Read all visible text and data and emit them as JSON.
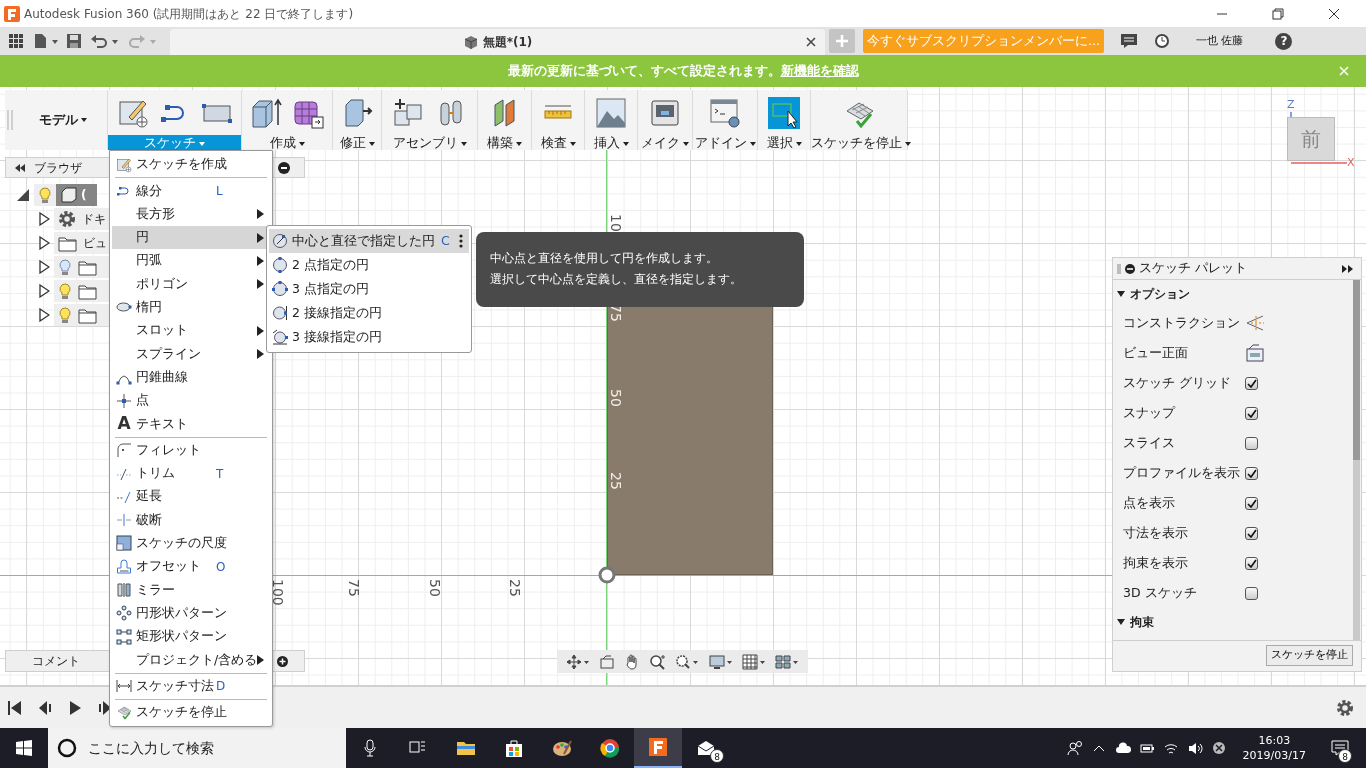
{
  "window": {
    "title": "Autodesk Fusion 360 (試用期間はあと 22 日で終了します)"
  },
  "tab_bar": {
    "document_tab": "無題*(1)",
    "subscribe_button": "今すぐサブスクリプションメンバーに...",
    "user": "一也 佐藤",
    "help": "?"
  },
  "banner": {
    "message": "最新の更新に基づいて、すべて設定されます。",
    "link": "新機能を確認"
  },
  "toolbar": {
    "workspace": "モデル",
    "groups": [
      {
        "label": "スケッチ",
        "selected": true,
        "active": false
      },
      {
        "label": "作成",
        "selected": false,
        "active": false
      },
      {
        "label": "修正",
        "selected": false,
        "active": false
      },
      {
        "label": "アセンブリ",
        "selected": false,
        "active": false
      },
      {
        "label": "構築",
        "selected": false,
        "active": false
      },
      {
        "label": "検査",
        "selected": false,
        "active": false
      },
      {
        "label": "挿入",
        "selected": false,
        "active": false
      },
      {
        "label": "メイク",
        "selected": false,
        "active": false
      },
      {
        "label": "アドイン",
        "selected": false,
        "active": false
      },
      {
        "label": "選択",
        "selected": false,
        "active": true
      },
      {
        "label": "スケッチを停止",
        "selected": false,
        "active": false
      }
    ]
  },
  "browser": {
    "title": "ブラウザ",
    "tree": [
      {
        "label": "(",
        "expanded": true,
        "visible": true,
        "children": [
          {
            "kind": "settings",
            "label": "ドキ",
            "expanded": false
          },
          {
            "kind": "folder",
            "label": "ビュ",
            "expanded": false
          },
          {
            "kind": "folder",
            "expanded": false,
            "visible": false
          },
          {
            "kind": "folder",
            "expanded": false,
            "visible": true
          },
          {
            "kind": "folder",
            "expanded": false,
            "visible": true
          }
        ]
      }
    ]
  },
  "sketch_menu": {
    "sections": [
      [
        {
          "label": "スケッチを作成",
          "submenu": false,
          "selected": false
        }
      ],
      [
        {
          "label": "線分",
          "shortcut": "L",
          "submenu": false,
          "selected": false
        },
        {
          "label": "長方形",
          "submenu": true,
          "selected": false
        },
        {
          "label": "円",
          "submenu": true,
          "selected": true
        },
        {
          "label": "円弧",
          "submenu": true,
          "selected": false
        },
        {
          "label": "ポリゴン",
          "submenu": true,
          "selected": false
        },
        {
          "label": "楕円",
          "submenu": false,
          "selected": false
        },
        {
          "label": "スロット",
          "submenu": true,
          "selected": false
        },
        {
          "label": "スプライン",
          "submenu": true,
          "selected": false
        },
        {
          "label": "円錐曲線",
          "submenu": false,
          "selected": false
        },
        {
          "label": "点",
          "submenu": false,
          "selected": false
        },
        {
          "label": "テキスト",
          "glyph": "A",
          "submenu": false,
          "selected": false
        }
      ],
      [
        {
          "label": "フィレット",
          "submenu": false,
          "selected": false
        },
        {
          "label": "トリム",
          "shortcut": "T",
          "submenu": false,
          "selected": false
        },
        {
          "label": "延長",
          "submenu": false,
          "selected": false
        },
        {
          "label": "破断",
          "submenu": false,
          "selected": false
        },
        {
          "label": "スケッチの尺度",
          "submenu": false,
          "selected": false
        },
        {
          "label": "オフセット",
          "shortcut": "O",
          "submenu": false,
          "selected": false
        },
        {
          "label": "ミラー",
          "submenu": false,
          "selected": false
        },
        {
          "label": "円形状パターン",
          "submenu": false,
          "selected": false
        },
        {
          "label": "矩形状パターン",
          "submenu": false,
          "selected": false
        },
        {
          "label": "プロジェクト/含める",
          "submenu": true,
          "selected": false
        }
      ],
      [
        {
          "label": "スケッチ寸法",
          "shortcut": "D",
          "submenu": false,
          "selected": false
        }
      ],
      [
        {
          "label": "スケッチを停止",
          "submenu": false,
          "selected": false
        }
      ]
    ]
  },
  "circle_submenu": {
    "items": [
      {
        "label": "中心と直径で指定した円",
        "shortcut": "C",
        "selected": true
      },
      {
        "label": "2 点指定の円",
        "selected": false
      },
      {
        "label": "3 点指定の円",
        "selected": false
      },
      {
        "label": "2 接線指定の円",
        "selected": false
      },
      {
        "label": "3 接線指定の円",
        "selected": false
      }
    ]
  },
  "tooltip": {
    "lines": [
      "中心点と直径を使用して円を作成します。",
      "選択して中心点を定義し、直径を指定します。"
    ]
  },
  "canvas": {
    "horizontal_ruler": [
      "100",
      "75",
      "50",
      "25"
    ],
    "vertical_ruler": [
      "10",
      "75",
      "50",
      "25"
    ]
  },
  "view_cube": {
    "face": "前",
    "axes": [
      "Z",
      "X"
    ]
  },
  "sketch_palette": {
    "title": "スケッチ パレット",
    "sections": [
      {
        "title": "オプション",
        "expanded": true,
        "rows": [
          {
            "kind": "icon",
            "label": "コンストラクション"
          },
          {
            "kind": "icon",
            "label": "ビュー正面"
          },
          {
            "kind": "checkbox",
            "label": "スケッチ グリッド",
            "checked": true
          },
          {
            "kind": "checkbox",
            "label": "スナップ",
            "checked": true
          },
          {
            "kind": "checkbox",
            "label": "スライス",
            "checked": false
          },
          {
            "kind": "checkbox",
            "label": "プロファイルを表示",
            "checked": true
          },
          {
            "kind": "checkbox",
            "label": "点を表示",
            "checked": true
          },
          {
            "kind": "checkbox",
            "label": "寸法を表示",
            "checked": true
          },
          {
            "kind": "checkbox",
            "label": "拘束を表示",
            "checked": true
          },
          {
            "kind": "checkbox",
            "label": "3D スケッチ",
            "checked": false
          }
        ]
      },
      {
        "title": "拘束",
        "expanded": true
      }
    ],
    "button": "スケッチを停止"
  },
  "comments_panel": {
    "title": "コメント"
  },
  "taskbar": {
    "search_placeholder": "ここに入力して検索",
    "mail_badge": "8",
    "time": "16:03",
    "date": "2019/03/17",
    "notifications": "8"
  }
}
